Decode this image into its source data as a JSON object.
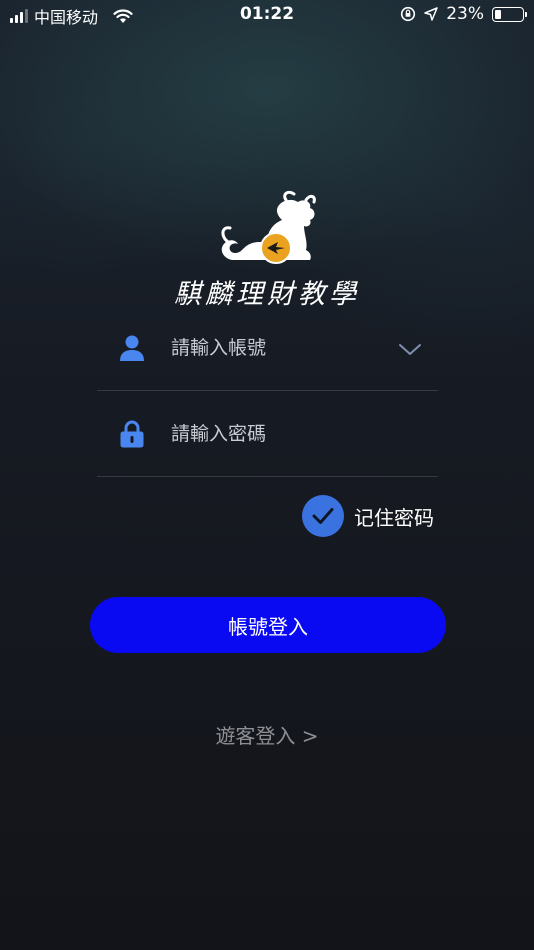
{
  "status_bar": {
    "carrier": "中国移动",
    "time": "01:22",
    "battery": "23%",
    "battery_level": 0.23
  },
  "logo": {
    "text": "騏麟理財教學"
  },
  "form": {
    "username_placeholder": "請輸入帳號",
    "password_placeholder": "請輸入密碼",
    "remember_label": "记住密码",
    "remember_checked": true
  },
  "buttons": {
    "login_label": "帳號登入",
    "guest_label": "遊客登入 >"
  },
  "colors": {
    "login_button": "#0a0af2",
    "checkbox": "#3a73e0",
    "icon_accent": "#4a86f0"
  }
}
